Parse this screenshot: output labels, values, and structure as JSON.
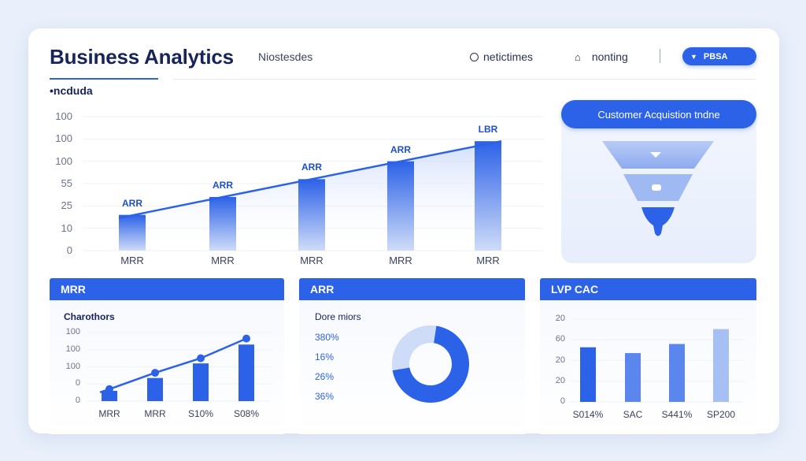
{
  "header": {
    "title": "Business Analytics",
    "subtitle": "Niostesdes",
    "nav": [
      {
        "label": "netictimes",
        "icon": "circle-icon"
      },
      {
        "label": "nonting",
        "icon": "home-icon"
      }
    ],
    "action_button": {
      "label": "PBSA",
      "icon": "arrow-down-icon"
    }
  },
  "section_label": "•ncduda",
  "main_chart": {
    "chart_data": {
      "type": "bar",
      "categories": [
        "MRR",
        "MRR",
        "MRR",
        "MRR",
        "MRR"
      ],
      "values": [
        16,
        24,
        32,
        40,
        49
      ],
      "data_labels": [
        "ARR",
        "ARR",
        "ARR",
        "ARR",
        "LBR"
      ],
      "y_ticks": [
        "100",
        "100",
        "100",
        "55",
        "25",
        "10",
        "0"
      ],
      "ylim": [
        0,
        60
      ],
      "trend_line": true,
      "accent": "#2c62e8"
    }
  },
  "funnel": {
    "title": "Customer Acquistion tndne",
    "stages": 3,
    "accent": "#2c62e8"
  },
  "panels": [
    {
      "title": "MRR",
      "subtitle": "Charothors",
      "chart_data": {
        "type": "bar",
        "categories": [
          "MRR",
          "MRR",
          "S10%",
          "S08%"
        ],
        "values": [
          12,
          27,
          44,
          66
        ],
        "line_values": [
          14,
          33,
          50,
          73
        ],
        "y_ticks": [
          "100",
          "100",
          "100",
          "0",
          "0"
        ],
        "ylim": [
          0,
          80
        ]
      }
    },
    {
      "title": "ARR",
      "subtitle": "Dore miors",
      "percent_labels": [
        "380%",
        "16%",
        "26%",
        "36%"
      ],
      "chart_data": {
        "type": "pie",
        "values": [
          70,
          30
        ],
        "colors": [
          "#2c62e8",
          "#cfdcf8"
        ]
      }
    },
    {
      "title": "LVP CAC",
      "chart_data": {
        "type": "bar",
        "categories": [
          "S014%",
          "SAC",
          "S441%",
          "SP200"
        ],
        "values": [
          66,
          59,
          70,
          88
        ],
        "y_ticks": [
          "20",
          "60",
          "20",
          "20",
          "0"
        ],
        "ylim": [
          0,
          100
        ]
      }
    }
  ]
}
